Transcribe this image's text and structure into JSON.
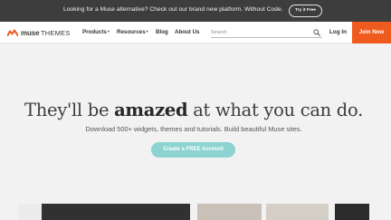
{
  "announcement": {
    "text": "Looking for a Muse alternative? Check out our brand new platform. Without Code.",
    "button_label": "Try it Free"
  },
  "logo": {
    "muse": "muse",
    "themes": "THEMES"
  },
  "nav": {
    "products": "Products",
    "resources": "Resources",
    "blog": "Blog",
    "about": "About Us"
  },
  "search": {
    "placeholder": "Search"
  },
  "account": {
    "login": "Log In",
    "join": "Join Now"
  },
  "hero": {
    "title_pre": "They'll be ",
    "title_bold": "amazed",
    "title_post": " at what you can do.",
    "subtitle": "Download 500+ widgets, themes and tutorials. Build beautiful Muse sites.",
    "cta": "Create a FREE Account"
  },
  "icons": {
    "logo": "muse-wave-logo-icon",
    "dropdown": "chevron-down-icon",
    "search": "search-icon"
  },
  "colors": {
    "announcement_bg": "#3d3d3d",
    "accent_orange": "#ef5a1e",
    "cta_teal": "#8cd3d1",
    "page_bg": "#f2f2f2"
  }
}
